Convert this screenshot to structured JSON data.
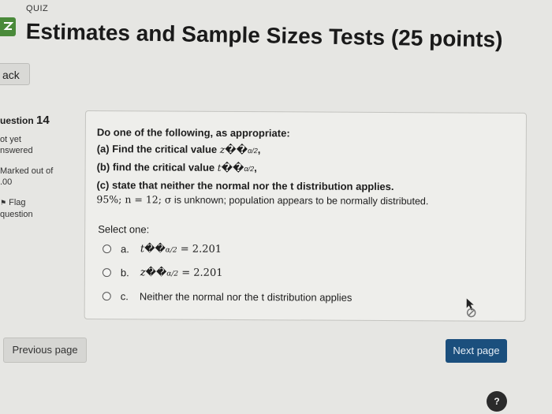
{
  "header": {
    "quiz_label": "QUIZ",
    "title": "Estimates and Sample Sizes Tests (25 points)"
  },
  "nav": {
    "back_label": "ack"
  },
  "info": {
    "question_prefix": "uestion",
    "question_number": "14",
    "status": "ot yet nswered",
    "marks": "Marked out of .00",
    "flag": "Flag question"
  },
  "question": {
    "intro": "Do one of the following, as appropriate:",
    "part_a_text": "(a) Find the critical value",
    "part_a_var": "z",
    "part_b_text": "(b) find the critical value",
    "part_b_var": "t",
    "glyphs": "��",
    "sub": "α/2",
    "part_c": "(c) state that neither the normal nor the t distribution applies.",
    "condition_math": "95%; n = 12; σ",
    "condition_text": " is unknown; population appears to be normally distributed.",
    "select_label": "Select one:",
    "options": [
      {
        "letter": "a.",
        "var": "t",
        "value": " = 2.201"
      },
      {
        "letter": "b.",
        "var": "z",
        "value": " = 2.201"
      },
      {
        "letter": "c.",
        "text": "Neither the normal nor the t distribution applies"
      }
    ]
  },
  "footer": {
    "previous_label": "Previous page",
    "next_label": "Next page",
    "help_label": "?"
  },
  "colors": {
    "accent": "#1b4f7d",
    "badge": "#4a8a3a",
    "background": "#e6e6e3"
  }
}
